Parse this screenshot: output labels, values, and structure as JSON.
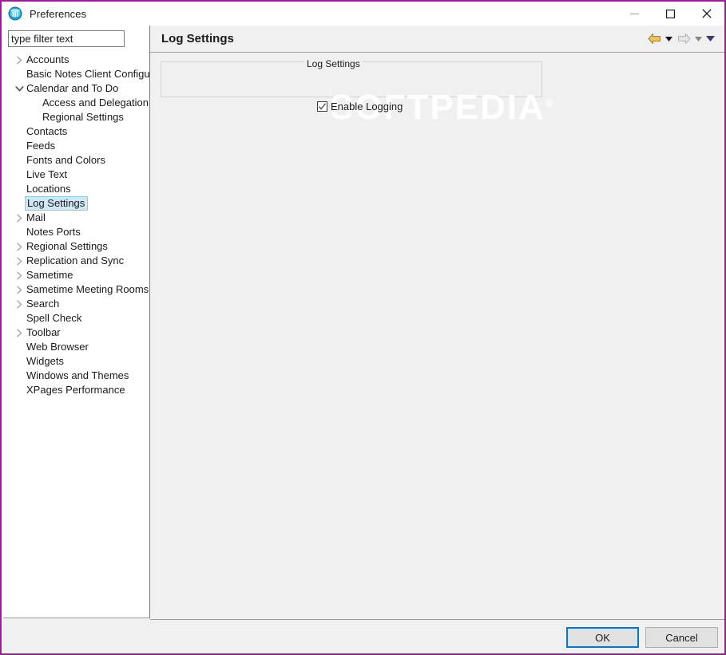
{
  "window": {
    "title": "Preferences",
    "icon": "notes-preferences-icon",
    "border_color": "#A2179B",
    "controls": {
      "minimize": "minimize-button",
      "maximize": "maximize-button",
      "close": "close-button"
    }
  },
  "filter": {
    "value": "type filter text",
    "placeholder": "type filter text"
  },
  "tree": {
    "items": [
      {
        "label": "Accounts",
        "indent": 0,
        "arrow": "collapsed",
        "selected": false
      },
      {
        "label": "Basic Notes Client Configura",
        "indent": 0,
        "arrow": "none",
        "selected": false
      },
      {
        "label": "Calendar and To Do",
        "indent": 0,
        "arrow": "expanded",
        "selected": false
      },
      {
        "label": "Access and Delegation",
        "indent": 1,
        "arrow": "none",
        "selected": false
      },
      {
        "label": "Regional Settings",
        "indent": 1,
        "arrow": "none",
        "selected": false
      },
      {
        "label": "Contacts",
        "indent": 0,
        "arrow": "none",
        "selected": false
      },
      {
        "label": "Feeds",
        "indent": 0,
        "arrow": "none",
        "selected": false
      },
      {
        "label": "Fonts and Colors",
        "indent": 0,
        "arrow": "none",
        "selected": false
      },
      {
        "label": "Live Text",
        "indent": 0,
        "arrow": "none",
        "selected": false
      },
      {
        "label": "Locations",
        "indent": 0,
        "arrow": "none",
        "selected": false
      },
      {
        "label": "Log Settings",
        "indent": 0,
        "arrow": "none",
        "selected": true
      },
      {
        "label": "Mail",
        "indent": 0,
        "arrow": "collapsed",
        "selected": false
      },
      {
        "label": "Notes Ports",
        "indent": 0,
        "arrow": "none",
        "selected": false
      },
      {
        "label": "Regional Settings",
        "indent": 0,
        "arrow": "collapsed",
        "selected": false
      },
      {
        "label": "Replication and Sync",
        "indent": 0,
        "arrow": "collapsed",
        "selected": false
      },
      {
        "label": "Sametime",
        "indent": 0,
        "arrow": "collapsed",
        "selected": false
      },
      {
        "label": "Sametime Meeting Rooms",
        "indent": 0,
        "arrow": "collapsed",
        "selected": false
      },
      {
        "label": "Search",
        "indent": 0,
        "arrow": "collapsed",
        "selected": false
      },
      {
        "label": "Spell Check",
        "indent": 0,
        "arrow": "none",
        "selected": false
      },
      {
        "label": "Toolbar",
        "indent": 0,
        "arrow": "collapsed",
        "selected": false
      },
      {
        "label": "Web Browser",
        "indent": 0,
        "arrow": "none",
        "selected": false
      },
      {
        "label": "Widgets",
        "indent": 0,
        "arrow": "none",
        "selected": false
      },
      {
        "label": "Windows and Themes",
        "indent": 0,
        "arrow": "none",
        "selected": false
      },
      {
        "label": "XPages Performance",
        "indent": 0,
        "arrow": "none",
        "selected": false
      }
    ],
    "selection_fill": "#CDE8F6",
    "selection_border": "#8EC9E8",
    "scrollbar": {
      "left_arrow": "‹",
      "right_arrow": "›"
    }
  },
  "page": {
    "title": "Log Settings",
    "nav": {
      "back": "back-arrow",
      "back_menu": "back-dropdown",
      "forward": "forward-arrow",
      "forward_menu": "forward-dropdown",
      "menu": "page-menu-dropdown",
      "back_color": "#E8B54A",
      "forward_color": "#D6D6D6",
      "menu_color": "#3B3B6E"
    },
    "group": {
      "legend": "Log Settings",
      "checkbox": {
        "label": "Enable Logging",
        "checked": true
      }
    }
  },
  "watermark": {
    "text": "SOFTPEDIA",
    "mark": "®"
  },
  "buttons": {
    "ok": "OK",
    "cancel": "Cancel",
    "focus_color": "#0078D7"
  }
}
